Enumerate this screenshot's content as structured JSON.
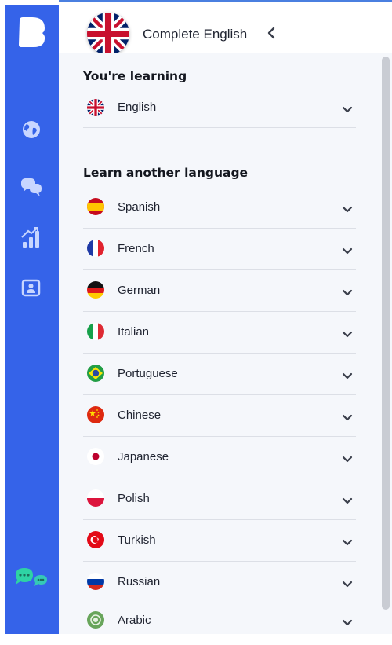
{
  "course": {
    "title": "Complete English",
    "flag": "uk-flag-icon"
  },
  "sidebar": {
    "items": [
      {
        "name": "explore",
        "icon": "globe-icon"
      },
      {
        "name": "community",
        "icon": "chat-bubbles-icon"
      },
      {
        "name": "progress",
        "icon": "chart-icon"
      },
      {
        "name": "classroom",
        "icon": "teacher-screen-icon"
      }
    ],
    "brand_color": "#3563e9",
    "chat_colors": [
      "#2ed3a4",
      "#35c9b7"
    ]
  },
  "learning": {
    "title": "You're learning",
    "languages": [
      {
        "label": "English",
        "flag": "uk"
      }
    ]
  },
  "another": {
    "title": "Learn another language",
    "languages": [
      {
        "label": "Spanish",
        "flag": "es"
      },
      {
        "label": "French",
        "flag": "fr"
      },
      {
        "label": "German",
        "flag": "de"
      },
      {
        "label": "Italian",
        "flag": "it"
      },
      {
        "label": "Portuguese",
        "flag": "br"
      },
      {
        "label": "Chinese",
        "flag": "cn"
      },
      {
        "label": "Japanese",
        "flag": "jp"
      },
      {
        "label": "Polish",
        "flag": "pl"
      },
      {
        "label": "Turkish",
        "flag": "tr"
      },
      {
        "label": "Russian",
        "flag": "ru"
      },
      {
        "label": "Arabic",
        "flag": "ar"
      }
    ]
  }
}
